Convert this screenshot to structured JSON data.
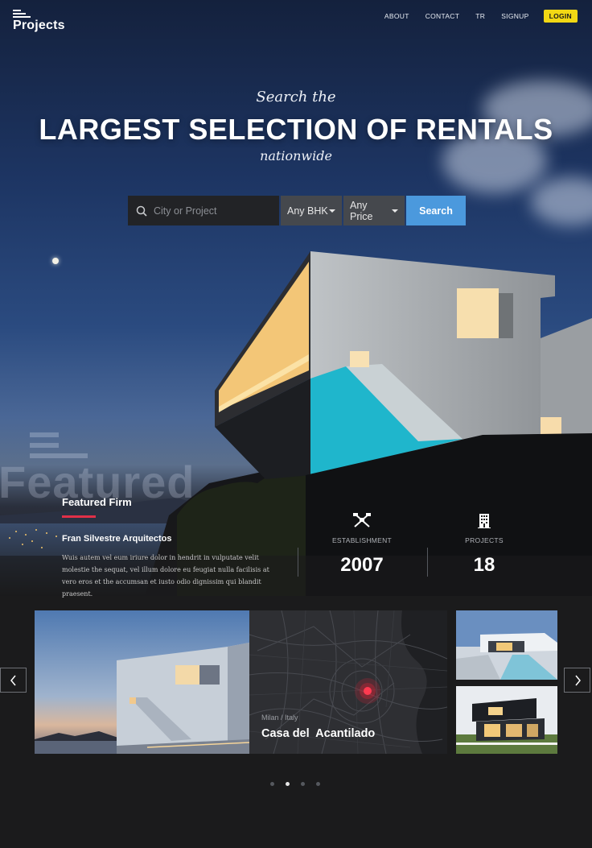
{
  "brand": {
    "logo_text": "Projects"
  },
  "nav": {
    "about": "ABOUT",
    "contact": "CONTACT",
    "tr": "TR",
    "signup": "SIGNUP",
    "login": "LOGIN"
  },
  "hero": {
    "pre_title": "Search the",
    "title": "LARGEST SELECTION OF RENTALS",
    "post_title": "nationwide"
  },
  "search": {
    "placeholder": "City or Project",
    "bhk_selected": "Any BHK",
    "price_selected": "Any Price",
    "button_label": "Search"
  },
  "featured": {
    "watermark": "Featured",
    "section_title": "Featured Firm",
    "firm_name": "Fran Silvestre Arquitectos",
    "description": "Wuis autem vel eum iriure dolor in hendrit in vulputate velit molestie the sequat, vel illum dolore eu feugiat nulla facilisis at vero eros et the accumsan et iusto odio dignissim qui blandit praesent.",
    "stats": [
      {
        "icon": "tools-icon",
        "label": "ESTABLISHMENT",
        "value": "2007"
      },
      {
        "icon": "building-icon",
        "label": "PROJECTS",
        "value": "18"
      }
    ]
  },
  "carousel": {
    "location": "Milan / Italy",
    "project_title": "Casa del  Acantilado",
    "dots": {
      "count": 4,
      "active_index": 1
    }
  },
  "colors": {
    "accent_yellow": "#f2d814",
    "search_blue": "#4b99dd",
    "underline_red": "#e03048",
    "map_pin": "#e0243a"
  }
}
